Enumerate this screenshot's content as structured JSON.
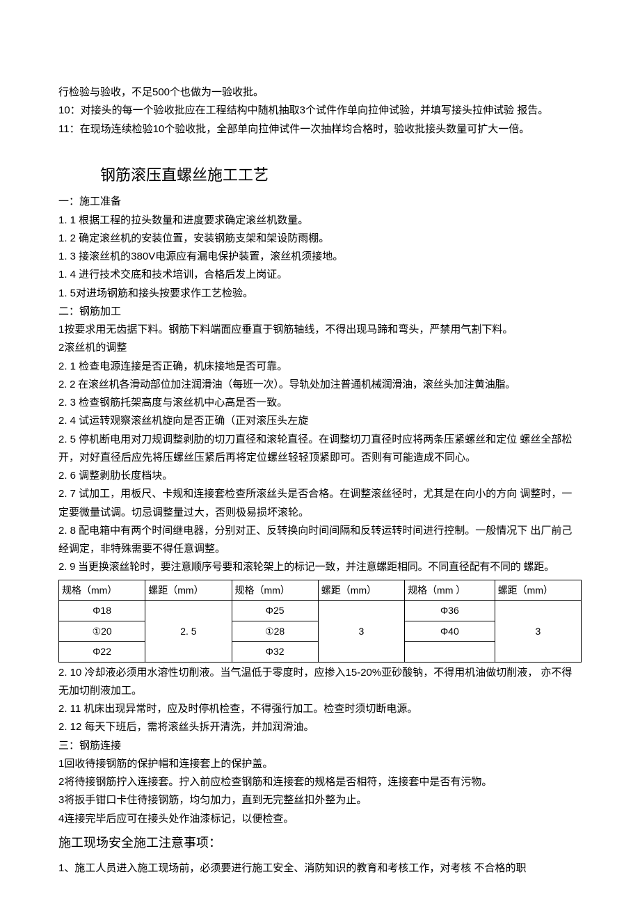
{
  "intro": {
    "line1": "行检验与验收，不足500个也做为一验收批。",
    "line2": "10：对接头的每一个验收批应在工程结构中随机抽取3个试件作单向拉伸试验，并填写接头拉伸试验 报告。",
    "line3": "11：在现场连续检验10个验收批，全部单向拉伸试件一次抽样均合格时，验收批接头数量可扩大一倍。"
  },
  "section1": {
    "title": "钢筋滚压直螺丝施工工艺",
    "prep": {
      "heading": "一：施工准备",
      "i1": "1. 1 根据工程的拉头数量和进度要求确定滚丝机数量。",
      "i2": "1. 2  确定滚丝机的安装位置，安装钢筋支架和架设防雨棚。",
      "i3": "1. 3  接滚丝机的380V电源应有漏电保护装置，滚丝机须接地。",
      "i4": "1. 4  进行技术交底和技术培训，合格后发上岗证。",
      "i5": "1.  5对进场钢筋和接头按要求作工艺检验。"
    },
    "process": {
      "heading": "二：钢筋加工",
      "p1": "1按要求用无齿据下料。钢筋下料端面应垂直于钢筋轴线，不得出现马蹄和弯头，严禁用气割下料。",
      "p2": "2滚丝机的调整",
      "p2_1": "2. 1  检查电源连接是否正确，机床接地是否可靠。",
      "p2_2": "2. 2  在滚丝机各滑动部位加注润滑油（每班一次）。导轨处加注普通机械润滑油，滚丝头加注黄油脂。",
      "p2_3": "2. 3  检查钢筋托架高度与滚丝机中心高是否一致。",
      "p2_4": "2. 4  试运转观察滚丝机旋向是否正确（正对滚压头左旋",
      "p2_5": "2. 5  停机断电用对刀规调整剥肋的切刀直径和滚轮直径。在调整切刀直径时应将两条压紧螺丝和定位 螺丝全部松开，对好直径后应先将压螺丝压紧后再将定位螺丝轻轻顶紧即可。否则有可能造成不同心。",
      "p2_6": "2. 6  调整剥肋长度档块。",
      "p2_7": "2. 7  试加工，用板尺、卡规和连接套检查所滚丝头是否合格。在调整滚丝径时，尤其是在向小的方向 调整时，一定要微量试调。切忌调整量过大，否则极易损坏滚轮。",
      "p2_8": "2. 8  配电箱中有两个时间继电器，分别对正、反转换向时间间隔和反转运转时间进行控制。一般情况下 出厂前己经调定，非特殊需要不得任意调整。",
      "p2_9": "2. 9  当更换滚丝轮时，要注意顺序号要和滚轮架上的标记一致，并注意螺距相同。不同直径配有不同的 螺距。",
      "p2_10": "2. 10  冷却液必须用水溶性切削液。当气温低于零度时，应掺入15-20%亚砂酸钠，不得用机油做切削液， 亦不得无加切削液加工。",
      "p2_11": "2. 11  机床出现异常时，应及时停机检查，不得强行加工。检查时须切断电源。",
      "p2_12": "2. 12  每天下班后，需将滚丝头拆开清洗，并加润滑油。"
    },
    "connect": {
      "heading": "三：钢筋连接",
      "c1": "1回收待接钢筋的保护帽和连接套上的保护盖。",
      "c2": "2将待接钢筋拧入连接套。拧入前应检查钢筋和连接套的规格是否相符，连接套中是否有污物。",
      "c3": "3将扳手钳口卡住待接钢筋，均匀加力，直到无完整丝扣外整为止。",
      "c4": "4连接完毕后应可在接头处作油漆标记，以便检查。"
    }
  },
  "table": {
    "headers": {
      "h1": "规格（mm）",
      "h2": "螺距（mm）",
      "h3": "规格（mm）",
      "h4": "螺距（mm）",
      "h5": "规格（mm ）",
      "h6": "螺距（mm）"
    },
    "rows": {
      "r0c0": "Φ18",
      "r1c0": "①20",
      "r2c0": "Φ22",
      "col1_pitch": "2. 5",
      "r0c2": "Φ25",
      "r1c2": "①28",
      "r2c2": "Φ32",
      "col3_pitch": "3",
      "r0c4": "Φ36",
      "r1c4": "Φ40",
      "col5_pitch": "3"
    }
  },
  "section2": {
    "title": "施工现场安全施工注意事项：",
    "p1": "1、施工人员进入施工现场前，必须要进行施工安全、消防知识的教育和考核工作，对考核 不合格的职"
  }
}
